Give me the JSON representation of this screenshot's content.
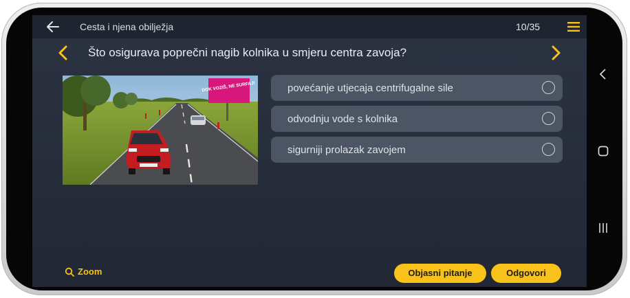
{
  "header": {
    "breadcrumb": "Cesta i njena obilježja",
    "counter": "10/35"
  },
  "question": {
    "text": "Što osigurava poprečni nagib kolnika u smjeru centra zavoja?"
  },
  "photo": {
    "billboard_text": "DOK VOZIŠ, NE SURFAJ!"
  },
  "answers": [
    {
      "label": "povećanje utjecaja centrifugalne sile"
    },
    {
      "label": "odvodnju vode s kolnika"
    },
    {
      "label": "sigurniji prolazak zavojem"
    }
  ],
  "footer": {
    "zoom_label": "Zoom",
    "explain_label": "Objasni pitanje",
    "answer_label": "Odgovori"
  },
  "colors": {
    "accent": "#f8c21a",
    "background": "#2a3140",
    "answer_bg": "#4c5564"
  },
  "icons": [
    "back-arrow-icon",
    "hamburger-menu-icon",
    "chevron-left-icon",
    "chevron-right-icon",
    "radio-icon",
    "search-icon",
    "android-back-icon",
    "android-home-icon",
    "android-recents-icon"
  ]
}
